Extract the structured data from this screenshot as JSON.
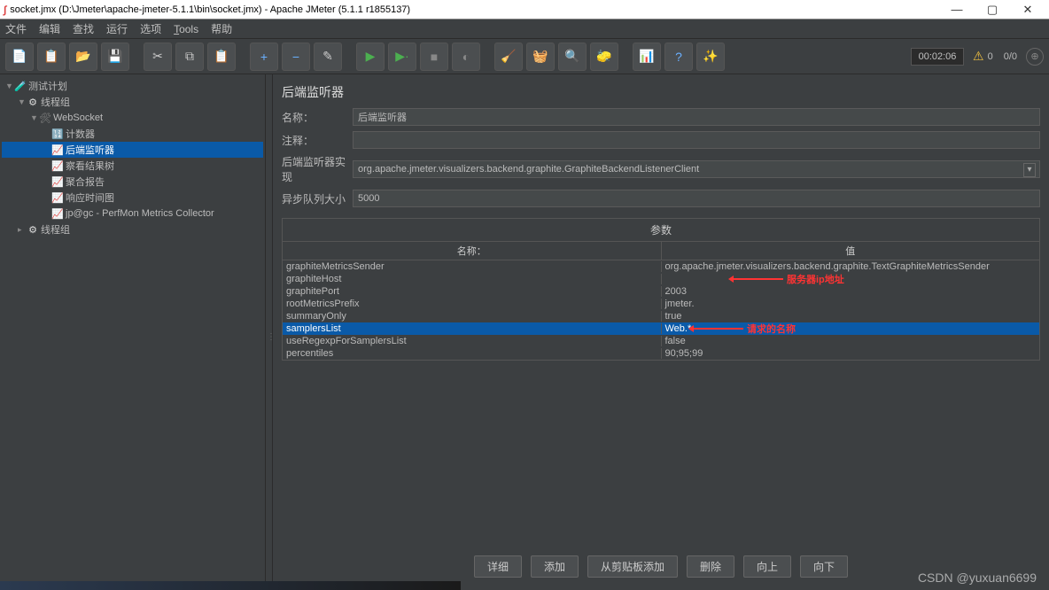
{
  "titlebar": {
    "text": "socket.jmx (D:\\Jmeter\\apache-jmeter-5.1.1\\bin\\socket.jmx) - Apache JMeter (5.1.1 r1855137)"
  },
  "menu": [
    "文件",
    "编辑",
    "查找",
    "运行",
    "选项",
    "Tools",
    "帮助"
  ],
  "toolbar": {
    "timer": "00:02:06",
    "warn_count": "0",
    "thread_stat": "0/0"
  },
  "tree": {
    "nodes": [
      {
        "indent": 0,
        "arrow": "▼",
        "icon": "beaker",
        "label": "测试计划"
      },
      {
        "indent": 1,
        "arrow": "▼",
        "icon": "gear",
        "label": "线程组"
      },
      {
        "indent": 2,
        "arrow": "▼",
        "icon": "wrench",
        "label": "WebSocket"
      },
      {
        "indent": 3,
        "arrow": "",
        "icon": "counter",
        "label": "计数器"
      },
      {
        "indent": 3,
        "arrow": "",
        "icon": "listener",
        "label": "后端监听器",
        "sel": true
      },
      {
        "indent": 3,
        "arrow": "",
        "icon": "listener",
        "label": "察看结果树"
      },
      {
        "indent": 3,
        "arrow": "",
        "icon": "listener",
        "label": "聚合报告"
      },
      {
        "indent": 3,
        "arrow": "",
        "icon": "listener",
        "label": "响应时间图"
      },
      {
        "indent": 3,
        "arrow": "",
        "icon": "listener",
        "label": "jp@gc - PerfMon Metrics Collector"
      },
      {
        "indent": 1,
        "arrow": "▸",
        "icon": "gear",
        "label": "线程组"
      }
    ]
  },
  "panel": {
    "title": "后端监听器",
    "name_label": "名称：",
    "name_value": "后端监听器",
    "comment_label": "注释：",
    "comment_value": "",
    "impl_label": "后端监听器实现",
    "impl_value": "org.apache.jmeter.visualizers.backend.graphite.GraphiteBackendListenerClient",
    "queue_label": "异步队列大小",
    "queue_value": "5000",
    "params_title": "参数",
    "col_name": "名称：",
    "col_value": "值",
    "rows": [
      {
        "name": "graphiteMetricsSender",
        "value": "org.apache.jmeter.visualizers.backend.graphite.TextGraphiteMetricsSender"
      },
      {
        "name": "graphiteHost",
        "value": ""
      },
      {
        "name": "graphitePort",
        "value": "2003"
      },
      {
        "name": "rootMetricsPrefix",
        "value": "jmeter."
      },
      {
        "name": "summaryOnly",
        "value": "true"
      },
      {
        "name": "samplersList",
        "value": "Web.*",
        "sel": true
      },
      {
        "name": "useRegexpForSamplersList",
        "value": "false"
      },
      {
        "name": "percentiles",
        "value": "90;95;99"
      }
    ]
  },
  "annotations": {
    "host": "服务器ip地址",
    "samplers": "请求的名称"
  },
  "buttons": [
    "详细",
    "添加",
    "从剪贴板添加",
    "删除",
    "向上",
    "向下"
  ],
  "watermark": "CSDN @yuxuan6699"
}
